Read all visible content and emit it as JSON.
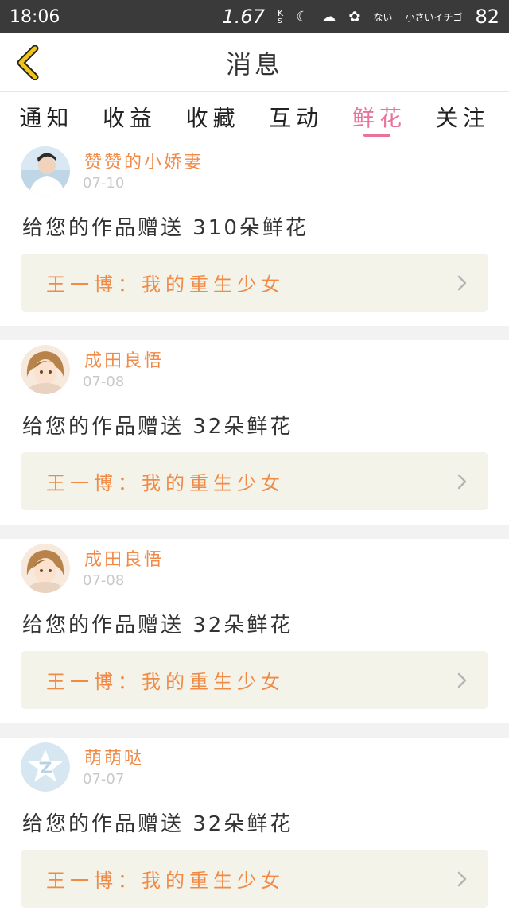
{
  "status_bar": {
    "time": "18:06",
    "speed": "1.67",
    "speed_unit_top": "K",
    "speed_unit_bottom": "s",
    "moon_glyph": "☾",
    "cloud_glyph": "☁",
    "flower_glyph": "✿",
    "text_1": "ない",
    "text_2": "小さいイチゴ",
    "battery": "82"
  },
  "header": {
    "title": "消息",
    "back_icon": "chevron-left-icon",
    "accent_color": "#f0c419"
  },
  "tabs": [
    {
      "label": "通知",
      "active": false
    },
    {
      "label": "收益",
      "active": false
    },
    {
      "label": "收藏",
      "active": false
    },
    {
      "label": "互动",
      "active": false
    },
    {
      "label": "鲜花",
      "active": true
    },
    {
      "label": "关注",
      "active": false
    }
  ],
  "colors": {
    "active_tab": "#e8749a",
    "username": "#f08a47",
    "link_background": "#f3f3ea"
  },
  "messages": [
    {
      "username": "赞赞的小娇妻",
      "date": "07-10",
      "text": "给您的作品赠送 310朵鲜花",
      "work_title": "王一博：我的重生少女",
      "avatar_icon": "user-photo-avatar"
    },
    {
      "username": "成田良悟",
      "date": "07-08",
      "text": "给您的作品赠送 32朵鲜花",
      "work_title": "王一博：我的重生少女",
      "avatar_icon": "anime-girl-avatar"
    },
    {
      "username": "成田良悟",
      "date": "07-08",
      "text": "给您的作品赠送 32朵鲜花",
      "work_title": "王一博：我的重生少女",
      "avatar_icon": "anime-girl-avatar"
    },
    {
      "username": "萌萌哒",
      "date": "07-07",
      "text": "给您的作品赠送 32朵鲜花",
      "work_title": "王一博：我的重生少女",
      "avatar_icon": "default-star-avatar"
    }
  ]
}
